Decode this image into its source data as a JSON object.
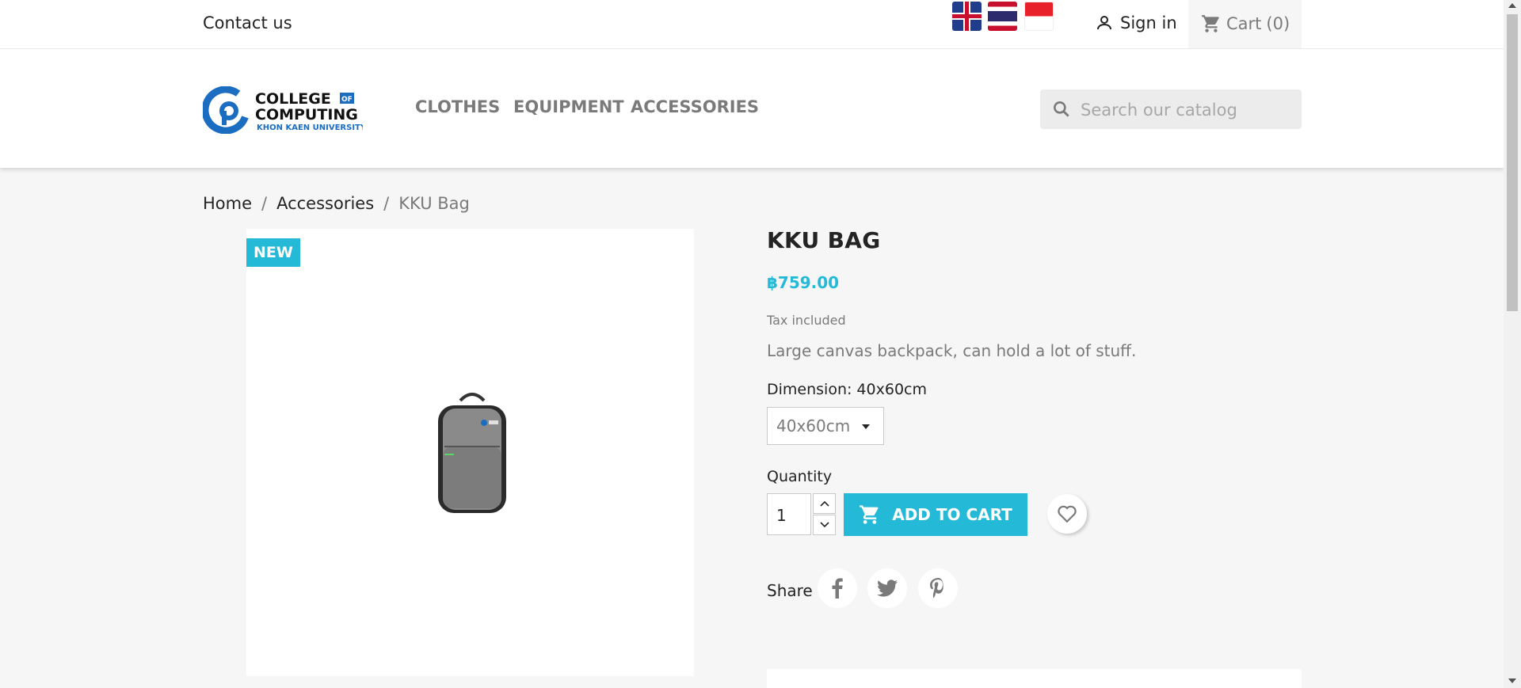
{
  "topbar": {
    "contact": "Contact us",
    "languages": [
      {
        "icon": "uk-flag-icon"
      },
      {
        "icon": "thailand-flag-icon"
      },
      {
        "icon": "indonesia-flag-icon"
      }
    ],
    "signin": "Sign in",
    "cart": "Cart",
    "cart_count": "(0)"
  },
  "header": {
    "logo": {
      "line1": "COLLEGE",
      "of": "OF",
      "line2": "COMPUTING",
      "line3": "KHON KAEN UNIVERSITY",
      "brand_color": "#1a6dc0"
    },
    "nav": [
      "CLOTHES",
      "EQUIPMENT",
      "ACCESSORIES"
    ],
    "search_placeholder": "Search our catalog"
  },
  "breadcrumb": {
    "home": "Home",
    "category": "Accessories",
    "current": "KKU Bag",
    "separator": "/"
  },
  "product": {
    "badge": "NEW",
    "title": "KKU BAG",
    "price": "฿759.00",
    "tax": "Tax included",
    "description": "Large canvas backpack, can hold a lot of stuff.",
    "dimension_label": "Dimension: 40x60cm",
    "dimension_value": "40x60cm",
    "quantity_label": "Quantity",
    "quantity": "1",
    "add_to_cart": "ADD TO CART",
    "share_label": "Share"
  },
  "colors": {
    "accent": "#24b9d7",
    "text": "#232323",
    "muted": "#7a7a7a"
  }
}
